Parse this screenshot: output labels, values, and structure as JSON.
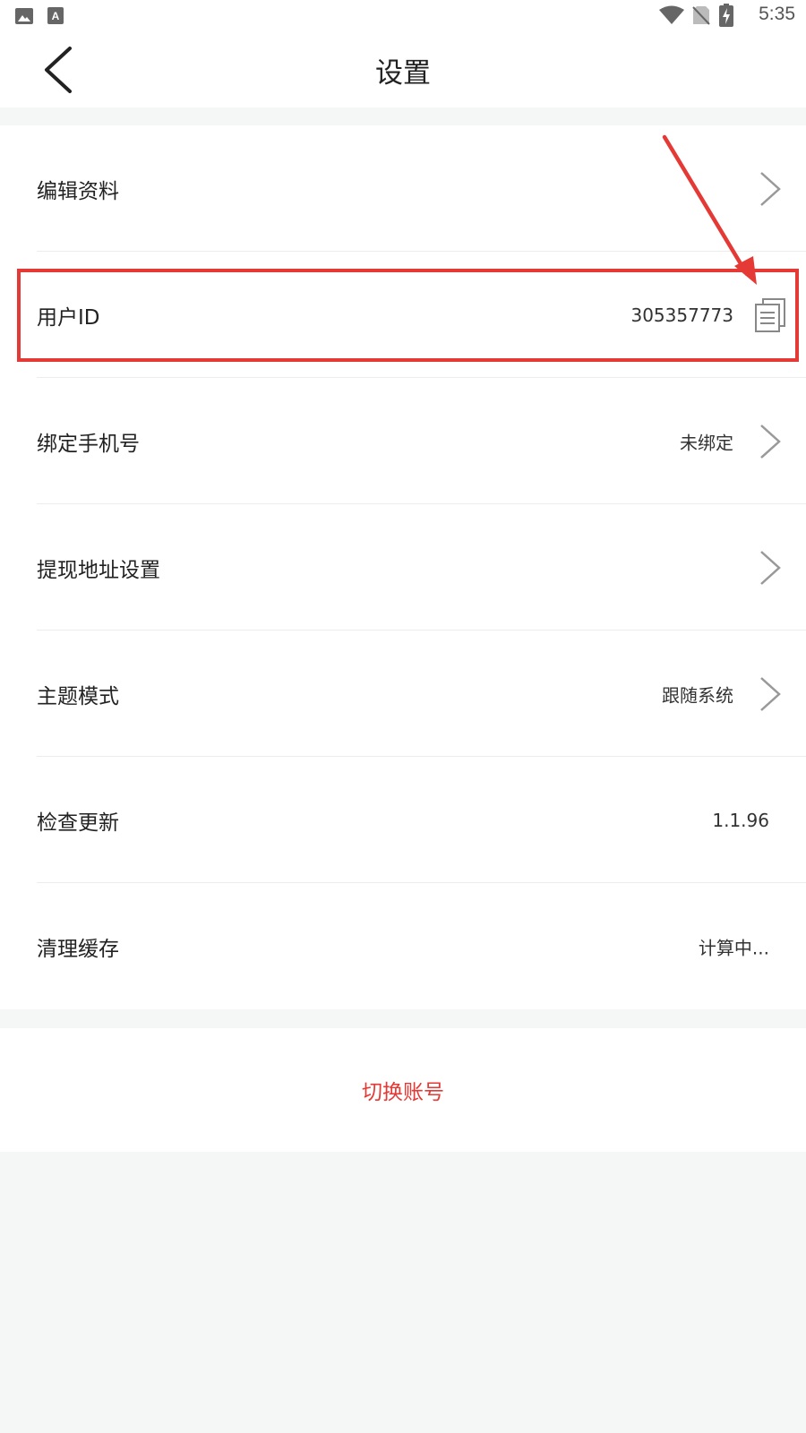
{
  "status_bar": {
    "time": "5:35",
    "icons": [
      "image-icon",
      "keyboard-a-icon",
      "wifi-icon",
      "no-sim-icon",
      "battery-charging-icon"
    ]
  },
  "header": {
    "title": "设置",
    "back_icon": "chevron-left-icon"
  },
  "settings": {
    "rows": [
      {
        "label": "编辑资料",
        "value": "",
        "action": "chevron-right-icon"
      },
      {
        "label": "用户ID",
        "value": "305357773",
        "action": "copy-icon"
      },
      {
        "label": "绑定手机号",
        "value": "未绑定",
        "action": "chevron-right-icon"
      },
      {
        "label": "提现地址设置",
        "value": "",
        "action": "chevron-right-icon"
      },
      {
        "label": "主题模式",
        "value": "跟随系统",
        "action": "chevron-right-icon"
      },
      {
        "label": "检查更新",
        "value": "1.1.96",
        "action": ""
      },
      {
        "label": "清理缓存",
        "value": "计算中...",
        "action": ""
      }
    ]
  },
  "switch_account": {
    "label": "切换账号",
    "color": "#e53935"
  },
  "annotation": {
    "color": "#e53935"
  }
}
